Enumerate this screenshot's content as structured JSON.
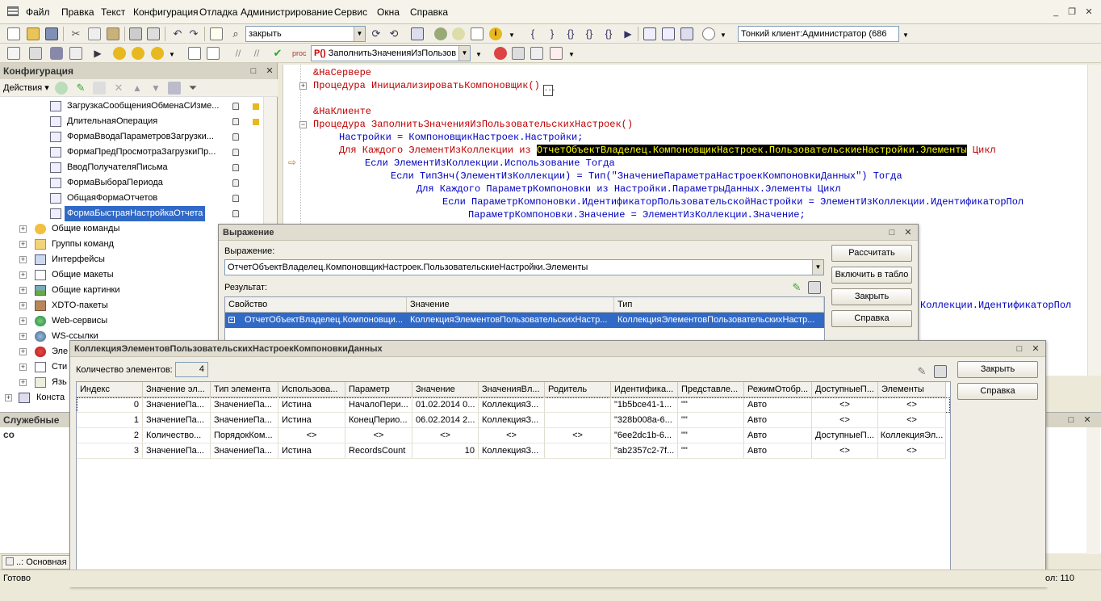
{
  "menu": [
    "Файл",
    "Правка",
    "Текст",
    "Конфигурация",
    "Отладка",
    "Администрирование",
    "Сервис",
    "Окна",
    "Справка"
  ],
  "toolbar1": {
    "search_value": "закрыть",
    "client_label": "Тонкий клиент:Администратор (686"
  },
  "toolbar2": {
    "procedure_combo": "ЗаполнитьЗначенияИзПользов"
  },
  "config_panel": {
    "title": "Конфигурация",
    "actions_label": "Действия",
    "items": [
      "ЗагрузкаСообщенияОбменаСИзме...",
      "ДлительнаяОперация",
      "ФормаВводаПараметровЗагрузки...",
      "ФормаПредПросмотраЗагрузкиПр...",
      "ВводПолучателяПисьма",
      "ФормаВыбораПериода",
      "ОбщаяФормаОтчетов",
      "ФормаБыстраяНастройкаОтчета"
    ],
    "groups": [
      "Общие команды",
      "Группы команд",
      "Интерфейсы",
      "Общие макеты",
      "Общие картинки",
      "XDTO-пакеты",
      "Web-сервисы",
      "WS-ссылки",
      "Эле",
      "Сти",
      "Язь",
      "Конста"
    ]
  },
  "service_panel": {
    "title": "Служебные со"
  },
  "code": {
    "lines": [
      "&НаСервере",
      "Процедура ИнициализироватьКомпоновщик()",
      "",
      "&НаКлиенте",
      "Процедура ЗаполнитьЗначенияИзПользовательскихНастроек()",
      "Настройки = КомпоновщикНастроек.Настройки;",
      "Для Каждого ЭлементИзКоллекции из ",
      "ОтчетОбъектВладелец.КомпоновщикНастроек.ПользовательскиеНастройки.Элементы",
      " Цикл",
      "Если ЭлементИзКоллекции.Использование Тогда",
      "Если ТипЗнч(ЭлементИзКоллекции) = Тип(\"ЗначениеПараметраНастроекКомпоновкиДанных\") Тогда",
      "Для Каждого ПараметрКомпоновки из Настройки.ПараметрыДанных.Элементы Цикл",
      "Если ПараметрКомпоновки.ИдентификаторПользовательскойНастройки = ЭлементИзКоллекции.ИдентификаторПол",
      "ПараметрКомпоновки.Значение = ЭлементИзКоллекции.Значение;",
      "Коллекции.ИдентификаторПол"
    ]
  },
  "expr_dialog": {
    "title": "Выражение",
    "expr_label": "Выражение:",
    "expr_value": "ОтчетОбъектВладелец.КомпоновщикНастроек.ПользовательскиеНастройки.Элементы",
    "result_label": "Результат:",
    "buttons": [
      "Рассчитать",
      "Включить в табло",
      "Закрыть",
      "Справка"
    ],
    "columns": [
      "Свойство",
      "Значение",
      "Тип"
    ],
    "row": [
      "ОтчетОбъектВладелец.Компоновщи...",
      "КоллекцияЭлементовПользовательскихНастр...",
      "КоллекцияЭлементовПользовательскихНастр..."
    ]
  },
  "coll_dialog": {
    "title": "КоллекцияЭлементовПользовательскихНастроекКомпоновкиДанных",
    "count_label": "Количество элементов:",
    "count_value": "4",
    "buttons": [
      "Закрыть",
      "Справка"
    ],
    "columns": [
      "Индекс",
      "Значение эл...",
      "Тип элемента",
      "Использова...",
      "Параметр",
      "Значение",
      "ЗначенияВл...",
      "Родитель",
      "Идентифика...",
      "Представле...",
      "РежимОтобр...",
      "ДоступныеП...",
      "Элементы"
    ],
    "rows": [
      [
        "0",
        "ЗначениеПа...",
        "ЗначениеПа...",
        "Истина",
        "НачалоПери...",
        "01.02.2014 0...",
        "КоллекцияЗ...",
        "",
        "\"1b5bce41-1...",
        "\"\"",
        "Авто",
        "<>",
        "<>"
      ],
      [
        "1",
        "ЗначениеПа...",
        "ЗначениеПа...",
        "Истина",
        "КонецПерио...",
        "06.02.2014 2...",
        "КоллекцияЗ...",
        "",
        "\"328b008a-6...",
        "\"\"",
        "Авто",
        "<>",
        "<>"
      ],
      [
        "2",
        "Количество...",
        "ПорядокКом...",
        "<>",
        "<>",
        "<>",
        "<>",
        "<>",
        "\"6ee2dc1b-6...",
        "\"\"",
        "Авто",
        "ДоступныеП...",
        "КоллекцияЭл..."
      ],
      [
        "3",
        "ЗначениеПа...",
        "ЗначениеПа...",
        "Истина",
        "RecordsCount",
        "10",
        "КоллекцияЗ...",
        "",
        "\"ab2357c2-7f...",
        "\"\"",
        "Авто",
        "<>",
        "<>"
      ]
    ]
  },
  "taskbar": {
    "label": "..: Основная"
  },
  "status": {
    "left": "Готово",
    "right": "ол: 110"
  }
}
